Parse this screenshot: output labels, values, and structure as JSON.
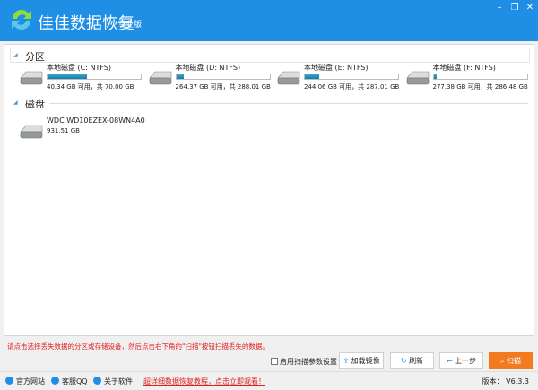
{
  "app": {
    "title": "佳佳数据恢复",
    "edition": "专业版",
    "icons": [
      "minimize-icon",
      "maximize-icon",
      "close-icon"
    ]
  },
  "sections": {
    "partitions": "分区",
    "disks": "磁盘"
  },
  "partitions": [
    {
      "name": "本地磁盘 (C: NTFS)",
      "info": "40.34 GB 可用，共 70.00 GB",
      "used_percent": 42
    },
    {
      "name": "本地磁盘 (D: NTFS)",
      "info": "264.37 GB 可用，共 288.01 GB",
      "used_percent": 8
    },
    {
      "name": "本地磁盘 (E: NTFS)",
      "info": "244.06 GB 可用，共 287.01 GB",
      "used_percent": 15
    },
    {
      "name": "本地磁盘 (F: NTFS)",
      "info": "277.38 GB 可用，共 286.48 GB",
      "used_percent": 3
    }
  ],
  "disks": [
    {
      "name": "WDC WD10EZEX-08WN4A0",
      "size": "931.51 GB"
    }
  ],
  "hint": "请点击选择丢失数据的分区或存储设备，然后点击右下角的\"扫描\"按钮扫描丢失的数据。",
  "toolbar": {
    "scan_params": "启用扫描参数设置",
    "load_image": "加载镜像",
    "refresh": "刷新",
    "back": "上一步",
    "scan": "扫描"
  },
  "colors": {
    "accent": "#1f8fe6",
    "scan": "#f47a20",
    "hint": "#e02020"
  },
  "footer": {
    "website": "官方网站",
    "qq": "客服QQ",
    "about": "关于软件",
    "tutorial_link": "超详细数据恢复教程，点击立即观看！",
    "version": "版本： V6.3.3"
  }
}
